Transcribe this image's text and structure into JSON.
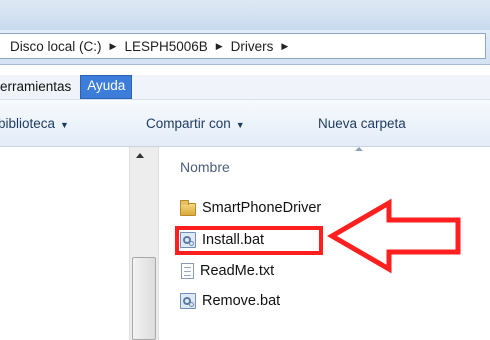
{
  "address": {
    "crumbs": [
      "Disco local (C:)",
      "LESPH5006B",
      "Drivers"
    ]
  },
  "menu": {
    "items": [
      {
        "label": "erramientas",
        "active": false
      },
      {
        "label": "Ayuda",
        "active": true
      }
    ]
  },
  "toolbar": {
    "library_label": "biblioteca",
    "share_label": "Compartir con",
    "new_folder_label": "Nueva carpeta"
  },
  "columns": {
    "name": "Nombre"
  },
  "files": [
    {
      "name": "SmartPhoneDriver",
      "icon": "folder-icon"
    },
    {
      "name": "Install.bat",
      "icon": "batch-file-icon",
      "highlighted": true
    },
    {
      "name": "ReadMe.txt",
      "icon": "text-file-icon"
    },
    {
      "name": "Remove.bat",
      "icon": "batch-file-icon"
    }
  ],
  "annotation": {
    "color": "#ff1f1f"
  }
}
